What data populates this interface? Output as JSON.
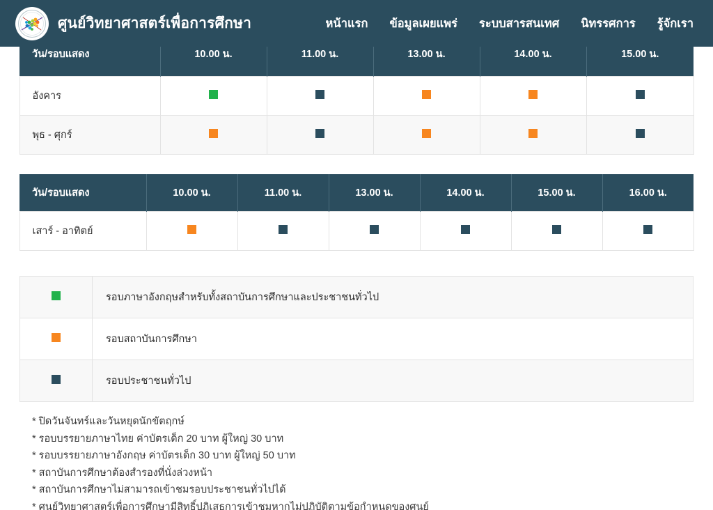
{
  "header": {
    "logo_icon": "science-center-emblem-icon",
    "title": "ศูนย์วิทยาศาสตร์เพื่อการศึกษา",
    "nav": [
      {
        "label": "หน้าแรก",
        "name": "nav-home"
      },
      {
        "label": "ข้อมูลเผยแพร่",
        "name": "nav-publications"
      },
      {
        "label": "ระบบสารสนเทศ",
        "name": "nav-information-system"
      },
      {
        "label": "นิทรรศการ",
        "name": "nav-exhibition"
      },
      {
        "label": "รู้จักเรา",
        "name": "nav-about-us"
      }
    ]
  },
  "colors": {
    "navbar": "#2b4d5e",
    "table_header": "#2b4d5e",
    "green": "#22b24c",
    "orange": "#f7861f",
    "navy": "#2b4d5e",
    "row_alt": "#f8f8f8",
    "border": "#e3e3e3"
  },
  "table_weekday": {
    "columns": [
      "วัน/รอบแสดง",
      "10.00 น.",
      "11.00 น.",
      "13.00 น.",
      "14.00 น.",
      "15.00 น."
    ],
    "rows": [
      {
        "day": "อังคาร",
        "markers": [
          "green",
          "navy",
          "orange",
          "orange",
          "navy"
        ]
      },
      {
        "day": "พุธ - ศุกร์",
        "markers": [
          "orange",
          "navy",
          "orange",
          "orange",
          "navy"
        ]
      }
    ]
  },
  "table_weekend": {
    "columns": [
      "วัน/รอบแสดง",
      "10.00 น.",
      "11.00 น.",
      "13.00 น.",
      "14.00 น.",
      "15.00 น.",
      "16.00 น."
    ],
    "rows": [
      {
        "day": "เสาร์ - อาทิตย์",
        "markers": [
          "orange",
          "navy",
          "navy",
          "navy",
          "navy",
          "navy"
        ]
      }
    ]
  },
  "legend": [
    {
      "color": "green",
      "label": "รอบภาษาอังกฤษสำหรับทั้งสถาบันการศึกษาและประชาชนทั่วไป"
    },
    {
      "color": "orange",
      "label": "รอบสถาบันการศึกษา"
    },
    {
      "color": "navy",
      "label": "รอบประชาชนทั่วไป"
    }
  ],
  "notes": [
    "* ปิดวันจันทร์และวันหยุดนักขัตฤกษ์",
    "* รอบบรรยายภาษาไทย ค่าบัตรเด็ก 20 บาท ผู้ใหญ่ 30 บาท",
    "* รอบบรรยายภาษาอังกฤษ ค่าบัตรเด็ก 30 บาท ผู้ใหญ่ 50 บาท",
    "* สถาบันการศึกษาต้องสำรองที่นั่งล่วงหน้า",
    "* สถาบันการศึกษาไม่สามารถเข้าชมรอบประชาชนทั่วไปได้",
    "* ศูนย์วิทยาศาสตร์เพื่อการศึกษามีสิทธิ์ปฏิเสธการเข้าชมหากไม่ปฏิบัติตามข้อกำหนดของศูนย์"
  ]
}
